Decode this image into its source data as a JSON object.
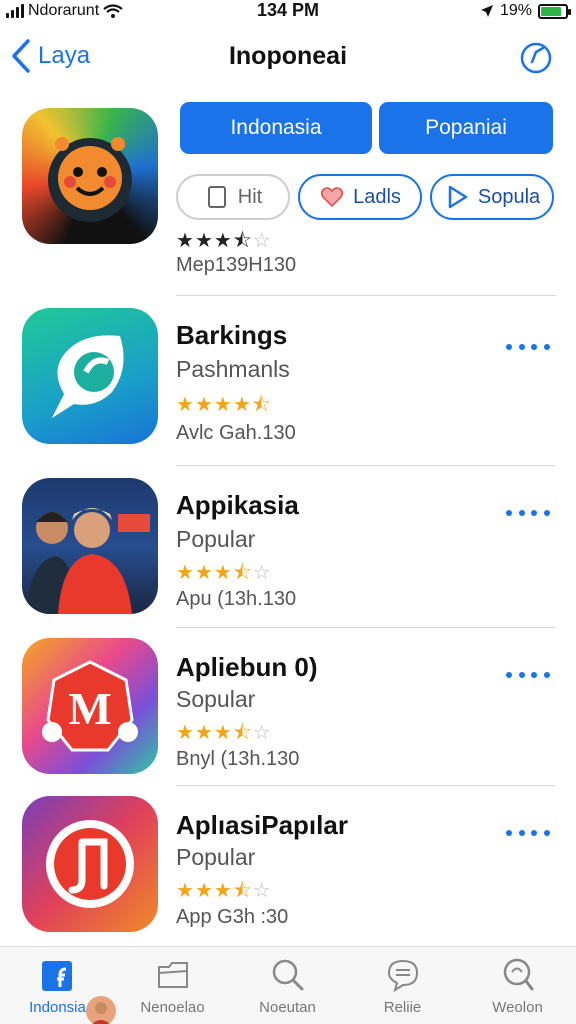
{
  "status_bar": {
    "carrier": "Ndorarunt",
    "time": "134 PM",
    "battery": "19%",
    "battery_level": 0.85
  },
  "nav": {
    "back_label": "Laya",
    "title": "Inoponeai",
    "back_icon": "chevron-left-icon",
    "action_icon": "compass-icon"
  },
  "header_app": {
    "primary_buttons": [
      "Indonasia",
      "Popaniai"
    ],
    "pills": [
      {
        "label": "Hit",
        "icon": "square-icon"
      },
      {
        "label": "Ladls",
        "icon": "heart-icon"
      },
      {
        "label": "Sopula",
        "icon": "play-icon"
      }
    ],
    "rating": 3.5,
    "meta": "Mep139H130"
  },
  "apps": [
    {
      "name": "Barkings",
      "subtitle": "Pashmanls",
      "rating": 4.5,
      "meta": "Avlc Gah.130"
    },
    {
      "name": "Appikasia",
      "subtitle": "Popular",
      "rating": 3.5,
      "meta": "Apu (13h.130"
    },
    {
      "name": "Apliebun 0)",
      "subtitle": "Sopular",
      "rating": 3.5,
      "meta": "Bnyl (13h.130"
    },
    {
      "name": "AplıasiPapılar",
      "subtitle": "Popular",
      "rating": 3.5,
      "meta": "App G3h :30"
    }
  ],
  "tabs": [
    {
      "label": "Indonsia",
      "icon": "news-icon",
      "active": true
    },
    {
      "label": "Nenoelao",
      "icon": "folder-icon",
      "active": false
    },
    {
      "label": "Noeutan",
      "icon": "search-icon",
      "active": false
    },
    {
      "label": "Reliie",
      "icon": "chat-icon",
      "active": false
    },
    {
      "label": "Weolon",
      "icon": "magnifier-icon",
      "active": false
    }
  ],
  "colors": {
    "accent": "#1a73e8",
    "star": "#f2a51a",
    "battery": "#2fb44a"
  }
}
